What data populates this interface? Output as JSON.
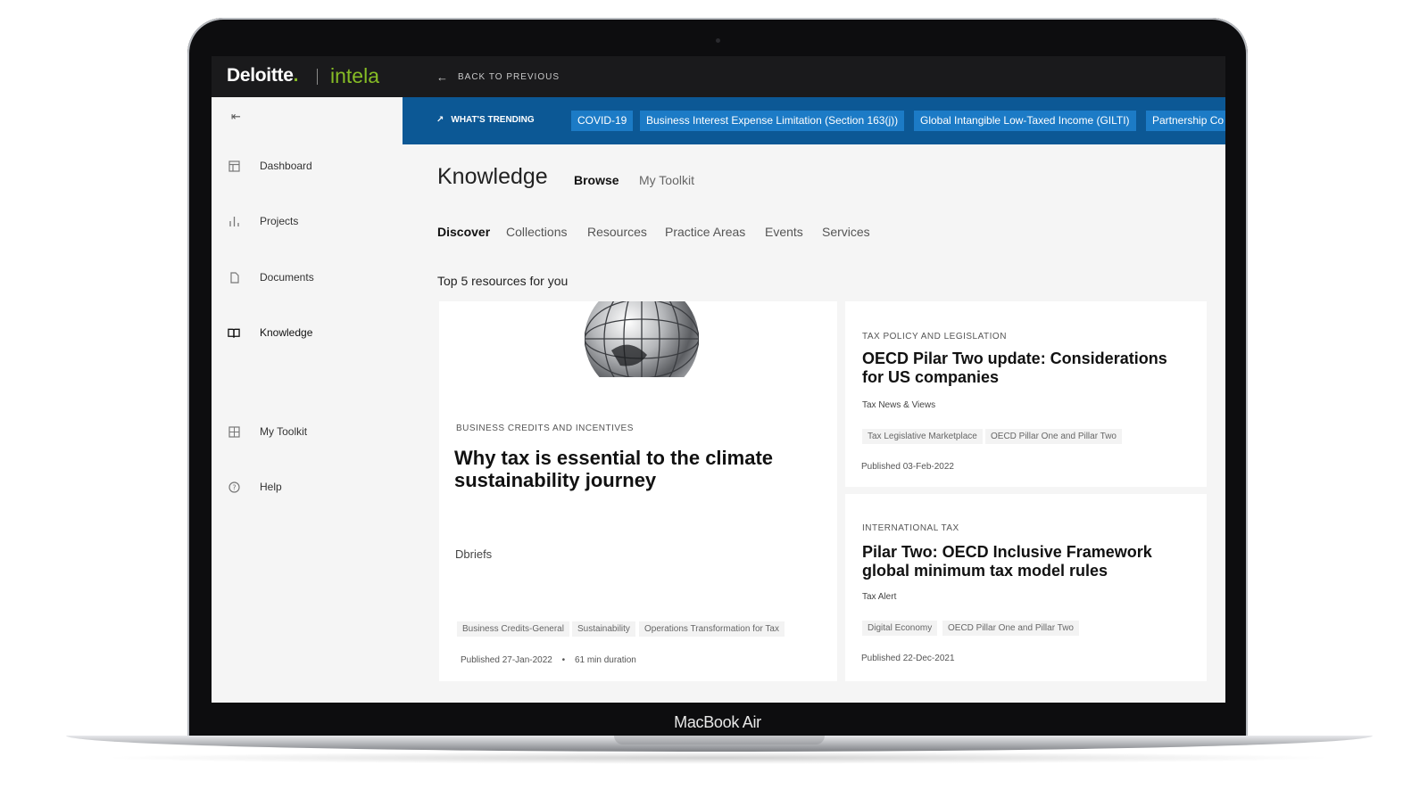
{
  "brand": {
    "name": "Deloitte",
    "dot": ".",
    "product": "intela"
  },
  "topbar": {
    "back_label": "BACK TO PREVIOUS"
  },
  "sidebar": {
    "items": [
      {
        "label": "Dashboard",
        "icon": "dashboard-icon"
      },
      {
        "label": "Projects",
        "icon": "bar-chart-icon"
      },
      {
        "label": "Documents",
        "icon": "document-icon"
      },
      {
        "label": "Knowledge",
        "icon": "book-icon",
        "active": true
      },
      {
        "label": "My Toolkit",
        "icon": "toolkit-icon"
      },
      {
        "label": "Help",
        "icon": "help-icon"
      }
    ]
  },
  "trending": {
    "label": "WHAT'S TRENDING",
    "chips": [
      "COVID-19",
      "Business Interest Expense Limitation (Section 163(j))",
      "Global Intangible Low-Taxed Income (GILTI)",
      "Partnership Co"
    ]
  },
  "knowledge": {
    "title": "Knowledge",
    "tabs": [
      "Browse",
      "My Toolkit"
    ],
    "subtabs": [
      "Discover",
      "Collections",
      "Resources",
      "Practice Areas",
      "Events",
      "Services"
    ],
    "section_heading": "Top 5 resources for you"
  },
  "cards": {
    "main": {
      "category": "BUSINESS CREDITS AND INCENTIVES",
      "title": "Why tax is essential to the climate sustainability journey",
      "source": "Dbriefs",
      "tags": [
        "Business Credits-General",
        "Sustainability",
        "Operations Transformation for Tax"
      ],
      "published": "Published 27-Jan-2022",
      "separator": "•",
      "duration": "61 min duration"
    },
    "right1": {
      "category": "TAX POLICY AND LEGISLATION",
      "title": "OECD Pilar Two update: Considerations for US companies",
      "source": "Tax News & Views",
      "tags": [
        "Tax Legislative Marketplace",
        "OECD Pillar One and Pillar Two"
      ],
      "published": "Published 03-Feb-2022"
    },
    "right2": {
      "category": "INTERNATIONAL TAX",
      "title": "Pilar Two: OECD Inclusive Framework global minimum tax model rules",
      "source": "Tax Alert",
      "tags": [
        "Digital Economy",
        "OECD Pillar One and Pillar Two"
      ],
      "published": "Published 22-Dec-2021"
    }
  },
  "device": {
    "label": "MacBook Air"
  },
  "colors": {
    "brand_green": "#86bc25",
    "trend_bar": "#0c5895",
    "chip": "#1c7bc6"
  }
}
